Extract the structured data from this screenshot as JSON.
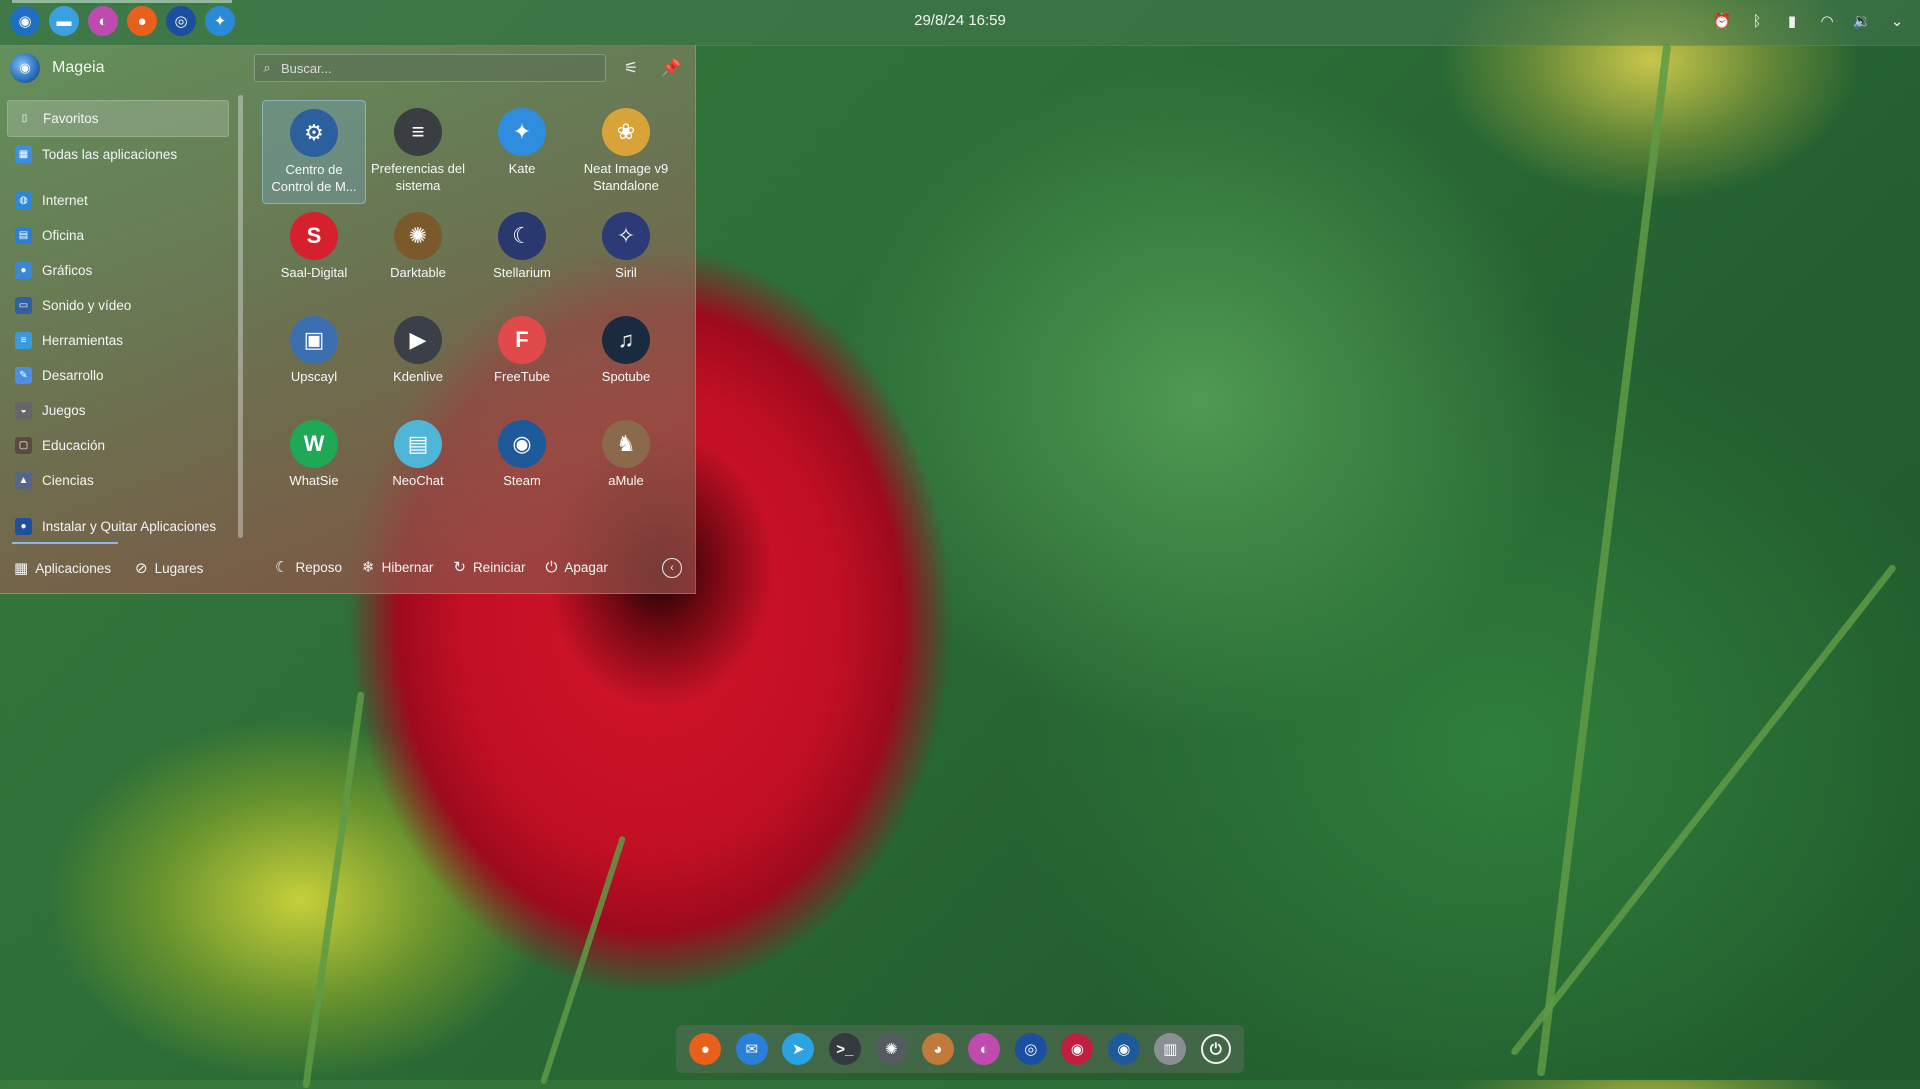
{
  "top_panel": {
    "clock": "29/8/24 16:59",
    "launchers": [
      {
        "icon": "mageia-icon",
        "glyph": "◉",
        "color": "#1e6fbf"
      },
      {
        "icon": "folder-icon",
        "glyph": "▬",
        "color": "#3aa0e0"
      },
      {
        "icon": "color-wheel-icon",
        "glyph": "◐",
        "color": "#c04bb0"
      },
      {
        "icon": "firefox-icon",
        "glyph": "●",
        "color": "#e8601c"
      },
      {
        "icon": "globe-icon",
        "glyph": "◎",
        "color": "#1b4fa0"
      },
      {
        "icon": "kate-icon",
        "glyph": "✦",
        "color": "#2a8ad8"
      }
    ],
    "tray": [
      {
        "icon": "alarm-icon",
        "glyph": "⏰"
      },
      {
        "icon": "bluetooth-icon",
        "glyph": "ᛒ"
      },
      {
        "icon": "battery-icon",
        "glyph": "▮"
      },
      {
        "icon": "wifi-icon",
        "glyph": "◠"
      },
      {
        "icon": "volume-icon",
        "glyph": "🔉"
      },
      {
        "icon": "chevron-down-icon",
        "glyph": "⌄"
      }
    ]
  },
  "menu": {
    "user_name": "Mageia",
    "search_placeholder": "Buscar...",
    "categories_top": [
      {
        "label": "Favoritos",
        "icon": "bookmark-icon",
        "color": "transparent",
        "glyph": "▯",
        "selected": true
      },
      {
        "label": "Todas las aplicaciones",
        "icon": "grid-icon",
        "color": "#3d8ee0",
        "glyph": "▦",
        "selected": false
      }
    ],
    "categories": [
      {
        "label": "Internet",
        "icon": "internet-icon",
        "color": "#2e86d8",
        "glyph": "◍"
      },
      {
        "label": "Oficina",
        "icon": "office-icon",
        "color": "#2c7fd0",
        "glyph": "▤"
      },
      {
        "label": "Gráficos",
        "icon": "graphics-icon",
        "color": "#3b87d6",
        "glyph": "●"
      },
      {
        "label": "Sonido y vídeo",
        "icon": "multimedia-icon",
        "color": "#2f5fa0",
        "glyph": "▭"
      },
      {
        "label": "Herramientas",
        "icon": "tools-icon",
        "color": "#3a9ae0",
        "glyph": "≡"
      },
      {
        "label": "Desarrollo",
        "icon": "development-icon",
        "color": "#4a8ee6",
        "glyph": "✎"
      },
      {
        "label": "Juegos",
        "icon": "gamepad-icon",
        "color": "#666666",
        "glyph": "◒"
      },
      {
        "label": "Educación",
        "icon": "education-icon",
        "color": "#5a4a40",
        "glyph": "▢"
      },
      {
        "label": "Ciencias",
        "icon": "science-icon",
        "color": "#556688",
        "glyph": "▲"
      }
    ],
    "install": {
      "label": "Instalar y Quitar Aplicaciones",
      "icon": "package-icon",
      "color": "#1f4f9f",
      "glyph": "●"
    },
    "favorites": [
      {
        "label": "Centro de Control de M...",
        "icon": "mageia-control-center-icon",
        "color": "#2b5f9e",
        "glyph": "⚙",
        "selected": true
      },
      {
        "label": "Preferencias del sistema",
        "icon": "system-settings-icon",
        "color": "#3a3d42",
        "glyph": "≡",
        "selected": false
      },
      {
        "label": "Kate",
        "icon": "kate-icon",
        "color": "#2f8de0",
        "glyph": "✦",
        "selected": false
      },
      {
        "label": "Neat Image v9 Standalone",
        "icon": "neat-image-icon",
        "color": "#d8a43a",
        "glyph": "❀",
        "selected": false
      },
      {
        "label": "Saal-Digital",
        "icon": "saal-digital-icon",
        "color": "#d6202e",
        "glyph": "S",
        "selected": false
      },
      {
        "label": "Darktable",
        "icon": "darktable-icon",
        "color": "#7a5a2a",
        "glyph": "✺",
        "selected": false
      },
      {
        "label": "Stellarium",
        "icon": "stellarium-icon",
        "color": "#2a3870",
        "glyph": "☾",
        "selected": false
      },
      {
        "label": "Siril",
        "icon": "siril-icon",
        "color": "#2c3a78",
        "glyph": "✧",
        "selected": false
      },
      {
        "label": "Upscayl",
        "icon": "upscayl-icon",
        "color": "#3c6fb0",
        "glyph": "▣",
        "selected": false
      },
      {
        "label": "Kdenlive",
        "icon": "kdenlive-icon",
        "color": "#3a3f48",
        "glyph": "▶",
        "selected": false
      },
      {
        "label": "FreeTube",
        "icon": "freetube-icon",
        "color": "#e04a4a",
        "glyph": "F",
        "selected": false
      },
      {
        "label": "Spotube",
        "icon": "spotube-icon",
        "color": "#1a2a3f",
        "glyph": "♫",
        "selected": false
      },
      {
        "label": "WhatSie",
        "icon": "whatsie-icon",
        "color": "#1fa855",
        "glyph": "W",
        "selected": false
      },
      {
        "label": "NeoChat",
        "icon": "neochat-icon",
        "color": "#4fb6d8",
        "glyph": "▤",
        "selected": false
      },
      {
        "label": "Steam",
        "icon": "steam-icon",
        "color": "#1e5a9a",
        "glyph": "◉",
        "selected": false
      },
      {
        "label": "aMule",
        "icon": "amule-icon",
        "color": "#8a6a4a",
        "glyph": "♞",
        "selected": false
      }
    ],
    "footer": {
      "applications": "Aplicaciones",
      "places": "Lugares",
      "sleep": "Reposo",
      "hibernate": "Hibernar",
      "restart": "Reiniciar",
      "shutdown": "Apagar"
    }
  },
  "dock": [
    {
      "icon": "firefox-icon",
      "glyph": "●",
      "color": "#e8601c"
    },
    {
      "icon": "thunderbird-icon",
      "glyph": "✉",
      "color": "#2a7fd6"
    },
    {
      "icon": "telegram-icon",
      "glyph": "➤",
      "color": "#2aa3e0"
    },
    {
      "icon": "terminal-icon",
      "glyph": ">_",
      "color": "#333a40"
    },
    {
      "icon": "aperture-icon",
      "glyph": "✺",
      "color": "#555b60"
    },
    {
      "icon": "gimp-icon",
      "glyph": "◕",
      "color": "#c07a3a"
    },
    {
      "icon": "color-wheel-icon",
      "glyph": "◐",
      "color": "#c04bb0"
    },
    {
      "icon": "globe-icon",
      "glyph": "◎",
      "color": "#1b4fa0"
    },
    {
      "icon": "record-icon",
      "glyph": "◉",
      "color": "#c02040"
    },
    {
      "icon": "steam-icon",
      "glyph": "◉",
      "color": "#1e5a9a"
    },
    {
      "icon": "trash-icon",
      "glyph": "▥",
      "color": "#8a8f94"
    },
    {
      "icon": "power-icon",
      "glyph": "⏻",
      "color": "transparent"
    }
  ]
}
